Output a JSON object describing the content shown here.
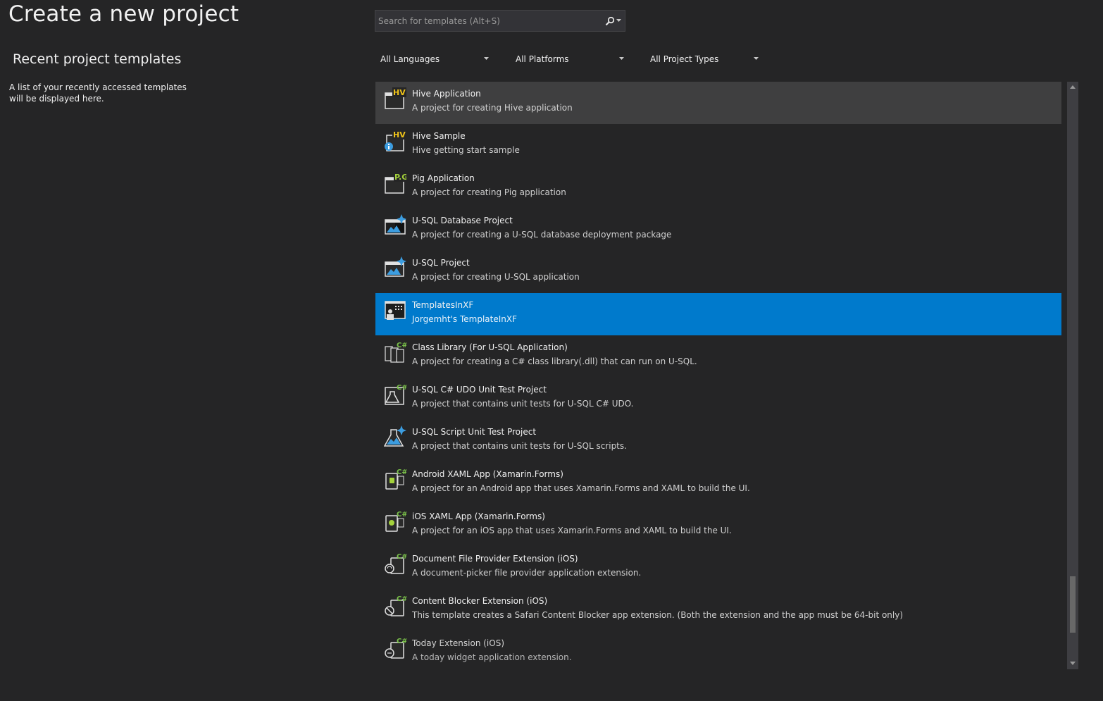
{
  "page_title": "Create a new project",
  "recent": {
    "title": "Recent project templates",
    "note": "A list of your recently accessed templates will be displayed here."
  },
  "search": {
    "placeholder": "Search for templates (Alt+S)",
    "value": "",
    "icon": "search-icon"
  },
  "filters": {
    "language": "All Languages",
    "platform": "All Platforms",
    "project_type": "All Project Types"
  },
  "templates": [
    {
      "name": "Hive Application",
      "description": "A project for creating Hive application",
      "icon": "hive-icon",
      "state": "hover"
    },
    {
      "name": "Hive Sample",
      "description": "Hive getting start sample",
      "icon": "hive-sample-icon",
      "state": ""
    },
    {
      "name": "Pig Application",
      "description": "A project for creating Pig application",
      "icon": "pig-icon",
      "state": ""
    },
    {
      "name": "U-SQL Database Project",
      "description": "A project for creating a U-SQL database deployment package",
      "icon": "usql-database-icon",
      "state": ""
    },
    {
      "name": "U-SQL Project",
      "description": "A project for creating U-SQL application",
      "icon": "usql-project-icon",
      "state": ""
    },
    {
      "name": "TemplatesInXF",
      "description": "Jorgemht's TemplateInXF",
      "icon": "templates-xf-icon",
      "state": "selected"
    },
    {
      "name": "Class Library (For U-SQL Application)",
      "description": "A project for creating a C# class library(.dll) that can run on U-SQL.",
      "icon": "class-library-icon",
      "state": ""
    },
    {
      "name": "U-SQL C# UDO Unit Test Project",
      "description": "A project that contains unit tests for U-SQL C# UDO.",
      "icon": "udo-test-icon",
      "state": ""
    },
    {
      "name": "U-SQL Script Unit Test Project",
      "description": "A project that contains unit tests for U-SQL scripts.",
      "icon": "script-test-icon",
      "state": ""
    },
    {
      "name": "Android XAML App (Xamarin.Forms)",
      "description": "A project for an Android app that uses Xamarin.Forms and XAML to build the UI.",
      "icon": "android-xaml-icon",
      "state": ""
    },
    {
      "name": "iOS XAML App (Xamarin.Forms)",
      "description": "A project for an iOS app that uses Xamarin.Forms and XAML to build the UI.",
      "icon": "ios-xaml-icon",
      "state": ""
    },
    {
      "name": "Document File Provider Extension (iOS)",
      "description": "A document-picker file provider application extension.",
      "icon": "document-provider-icon",
      "state": ""
    },
    {
      "name": "Content Blocker Extension (iOS)",
      "description": "This template creates a Safari Content Blocker app extension. (Both the extension and the app must be 64-bit only)",
      "icon": "content-blocker-icon",
      "state": ""
    },
    {
      "name": "Today Extension (iOS)",
      "description": "A today widget application extension.",
      "icon": "today-extension-icon",
      "state": "faded"
    }
  ],
  "colors": {
    "background": "#252526",
    "selected": "#007acc",
    "hover": "#3f3f40",
    "hive_label": "#f0c419",
    "pig_label": "#a4d23b",
    "csharp_label": "#7bc24a",
    "accent_blue": "#3c9de0"
  }
}
